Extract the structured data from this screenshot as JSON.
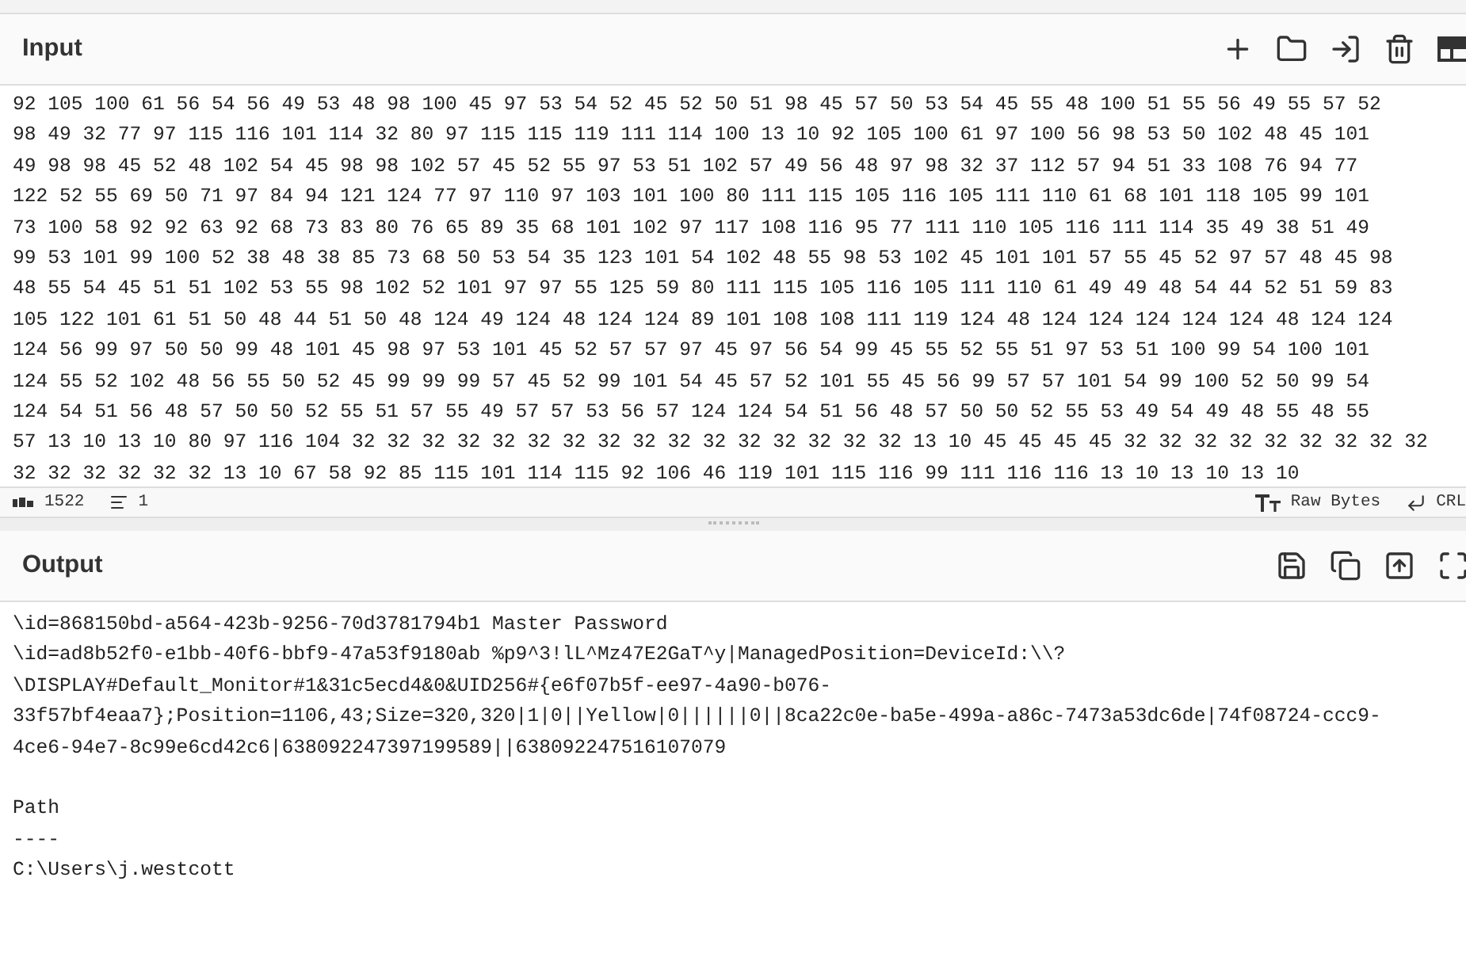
{
  "input": {
    "title": "Input",
    "lines": [
      "92 105 100 61 56 54 56 49 53 48 98 100 45 97 53 54 52 45 52 50 51 98 45 57 50 53 54 45 55 48 100 51 55 56 49 55 57 52",
      "98 49 32 77 97 115 116 101 114 32 80 97 115 115 119 111 114 100 13 10 92 105 100 61 97 100 56 98 53 50 102 48 45 101",
      "49 98 98 45 52 48 102 54 45 98 98 102 57 45 52 55 97 53 51 102 57 49 56 48 97 98 32 37 112 57 94 51 33 108 76 94 77",
      "122 52 55 69 50 71 97 84 94 121 124 77 97 110 97 103 101 100 80 111 115 105 116 105 111 110 61 68 101 118 105 99 101",
      "73 100 58 92 92 63 92 68 73 83 80 76 65 89 35 68 101 102 97 117 108 116 95 77 111 110 105 116 111 114 35 49 38 51 49",
      "99 53 101 99 100 52 38 48 38 85 73 68 50 53 54 35 123 101 54 102 48 55 98 53 102 45 101 101 57 55 45 52 97 57 48 45 98",
      "48 55 54 45 51 51 102 53 55 98 102 52 101 97 97 55 125 59 80 111 115 105 116 105 111 110 61 49 49 48 54 44 52 51 59 83",
      "105 122 101 61 51 50 48 44 51 50 48 124 49 124 48 124 124 89 101 108 108 111 119 124 48 124 124 124 124 124 48 124 124",
      "124 56 99 97 50 50 99 48 101 45 98 97 53 101 45 52 57 57 97 45 97 56 54 99 45 55 52 55 51 97 53 51 100 99 54 100 101",
      "124 55 52 102 48 56 55 50 52 45 99 99 99 57 45 52 99 101 54 45 57 52 101 55 45 56 99 57 57 101 54 99 100 52 50 99 54",
      "124 54 51 56 48 57 50 50 52 55 51 57 55 49 57 57 53 56 57 124 124 54 51 56 48 57 50 50 52 55 53 49 54 49 48 55 48 55",
      "57 13 10 13 10 80 97 116 104 32 32 32 32 32 32 32 32 32 32 32 32 32 32 32 32 13 10 45 45 45 45 32 32 32 32 32 32 32 32 32",
      "32 32 32 32 32 32 13 10 67 58 92 85 115 101 114 115 92 106 46 119 101 115 116 99 111 116 116 13 10 13 10 13 10"
    ]
  },
  "status_bar": {
    "characters": "1522",
    "lines": "1",
    "encoding": "Raw Bytes",
    "line_ending": "CRL"
  },
  "output": {
    "title": "Output",
    "paragraphs": [
      [
        "\\id=868150bd-a564-423b-9256-70d3781794b1 Master Password",
        "\\id=ad8b52f0-e1bb-40f6-bbf9-47a53f9180ab %p9^3!lL^Mz47E2GaT^y|ManagedPosition=DeviceId:\\\\?",
        "\\DISPLAY#Default_Monitor#1&31c5ecd4&0&UID256#{e6f07b5f-ee97-4a90-b076-",
        "33f57bf4eaa7};Position=1106,43;Size=320,320|1|0||Yellow|0||||||0||8ca22c0e-ba5e-499a-a86c-7473a53dc6de|74f08724-ccc9-",
        "4ce6-94e7-8c99e6cd42c6|638092247397199589||638092247516107079"
      ],
      [
        "Path",
        "----",
        "C:\\Users\\j.westcott"
      ]
    ]
  }
}
